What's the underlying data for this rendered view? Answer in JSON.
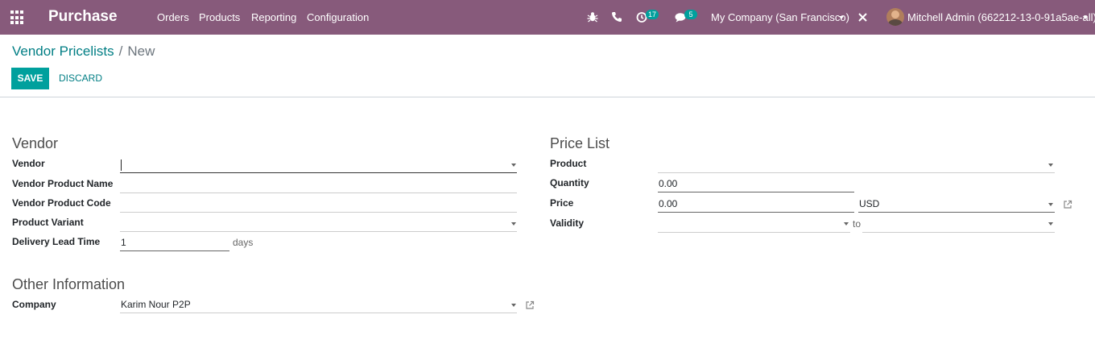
{
  "navbar": {
    "app_name": "Purchase",
    "menu": [
      "Orders",
      "Products",
      "Reporting",
      "Configuration"
    ],
    "activity_count": "17",
    "message_count": "5",
    "company": "My Company (San Francisco)",
    "user": "Mitchell Admin (662212-13-0-91a5ae-all)",
    "accent_color": "#875A7B"
  },
  "breadcrumb": {
    "parent": "Vendor Pricelists",
    "separator": "/",
    "current": "New"
  },
  "buttons": {
    "save": "SAVE",
    "discard": "DISCARD"
  },
  "vendor_group": {
    "title": "Vendor",
    "vendor_label": "Vendor",
    "vendor_value": "",
    "product_name_label": "Vendor Product Name",
    "product_name_value": "",
    "product_code_label": "Vendor Product Code",
    "product_code_value": "",
    "variant_label": "Product Variant",
    "variant_value": "",
    "lead_time_label": "Delivery Lead Time",
    "lead_time_value": "1",
    "lead_time_unit": "days"
  },
  "pricelist_group": {
    "title": "Price List",
    "product_label": "Product",
    "product_value": "",
    "quantity_label": "Quantity",
    "quantity_value": "0.00",
    "price_label": "Price",
    "price_value": "0.00",
    "currency_value": "USD",
    "validity_label": "Validity",
    "validity_from": "",
    "validity_to_sep": "to",
    "validity_to": ""
  },
  "other_group": {
    "title": "Other Information",
    "company_label": "Company",
    "company_value": "Karim Nour P2P"
  }
}
